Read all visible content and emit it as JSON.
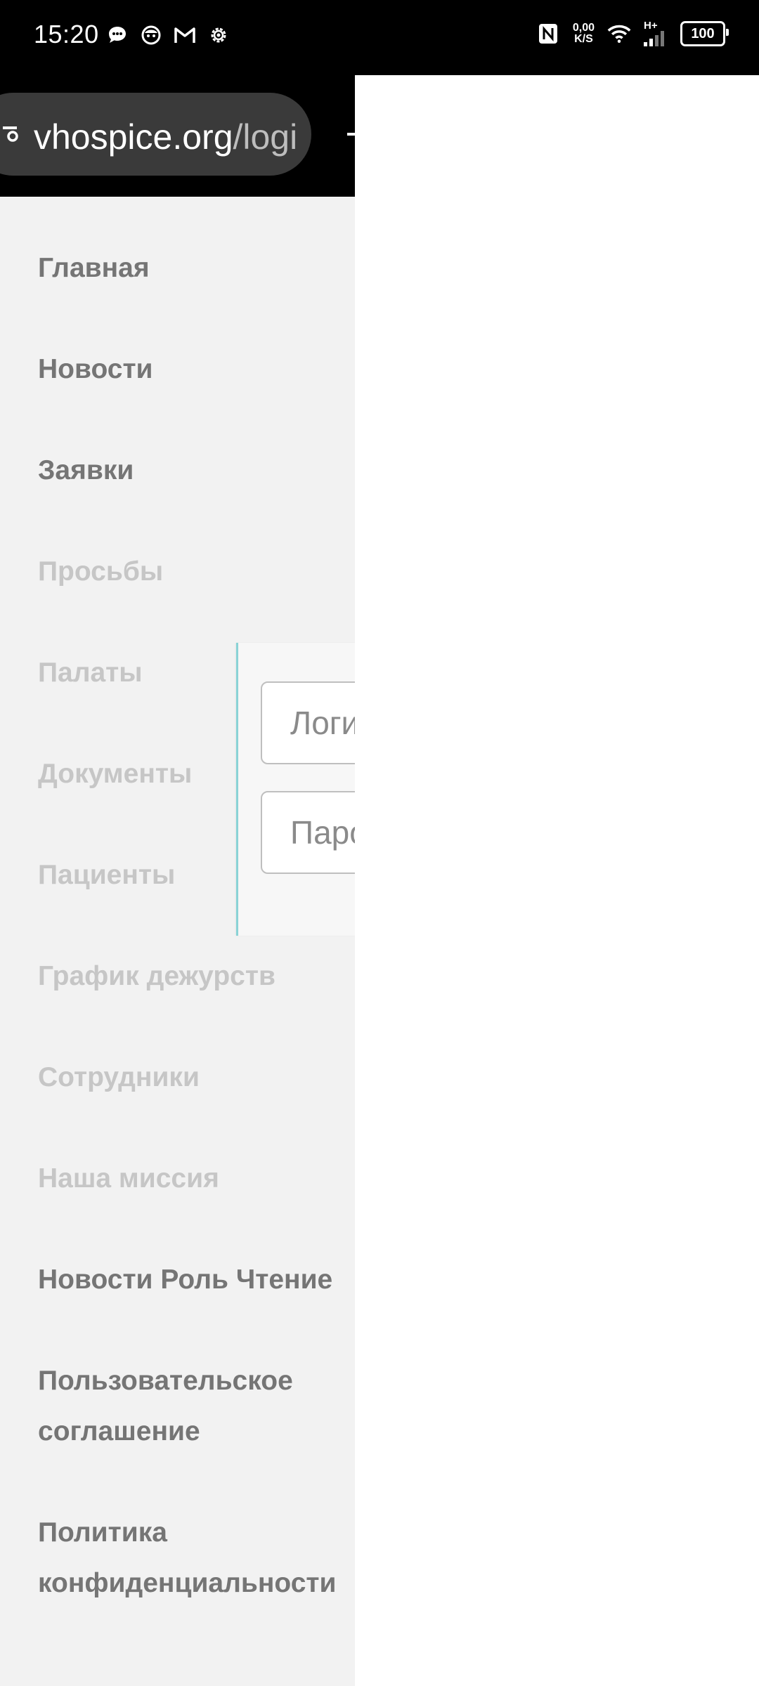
{
  "status_bar": {
    "time": "15:20",
    "net_speed_value": "0,00",
    "net_speed_unit": "K/S",
    "network_type": "H+",
    "battery": "100",
    "left_icons": [
      "message-icon",
      "app-face-icon",
      "gmail-icon",
      "settings-gear-icon"
    ],
    "right_icons": [
      "nfc-icon",
      "wifi-icon",
      "signal-icon",
      "battery-icon"
    ]
  },
  "browser": {
    "url_domain": "vhospice.org",
    "url_path": "/logi"
  },
  "drawer": {
    "items": [
      {
        "label": "Главная",
        "enabled": true
      },
      {
        "label": "Новости",
        "enabled": true
      },
      {
        "label": "Заявки",
        "enabled": true
      },
      {
        "label": "Просьбы",
        "enabled": false
      },
      {
        "label": "Палаты",
        "enabled": false
      },
      {
        "label": "Документы",
        "enabled": false
      },
      {
        "label": "Пациенты",
        "enabled": false
      },
      {
        "label": "График дежурств",
        "enabled": false
      },
      {
        "label": "Сотрудники",
        "enabled": false
      },
      {
        "label": "Наша миссия",
        "enabled": false
      },
      {
        "label": "Новости Роль Чтение",
        "enabled": true
      },
      {
        "label": "Пользовательское",
        "label2": "соглашение",
        "enabled": true
      },
      {
        "label": "Политика",
        "label2": "конфиденциальности",
        "enabled": true
      }
    ]
  },
  "login": {
    "login_placeholder": "Логи",
    "password_placeholder": "Паро"
  }
}
